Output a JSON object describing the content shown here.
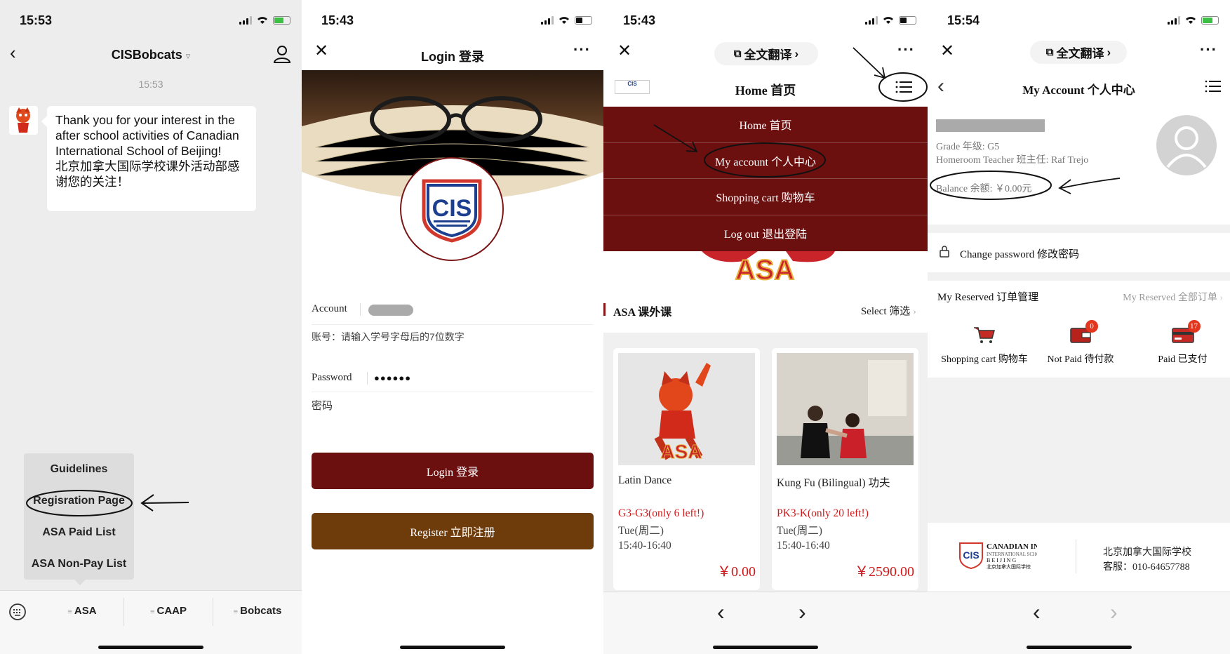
{
  "panel1": {
    "time": "15:53",
    "title": "CISBobcats",
    "timestamp": "15:53",
    "message": "Thank you for your interest in the after school activities of Canadian International School of Beijing!\n北京加拿大国际学校课外活动部感谢您的关注！",
    "menu": [
      "Guidelines",
      "Regisration Page",
      "ASA Paid List",
      "ASA Non-Pay List"
    ],
    "tabs": [
      "ASA",
      "CAAP",
      "Bobcats"
    ]
  },
  "panel2": {
    "time": "15:43",
    "title": "Login 登录",
    "logo_text": "CIS",
    "account_label": "Account",
    "account_placeholder": "账号：请输入学号字母后的7位数字",
    "password_label": "Password",
    "password_value": "●●●●●●",
    "password_placeholder": "密码",
    "login_button": "Login 登录",
    "register_button": "Register 立即注册"
  },
  "panel3": {
    "time": "15:43",
    "translate": "全文翻译",
    "header_title": "Home 首页",
    "menu": [
      "Home 首页",
      "My account 个人中心",
      "Shopping cart 购物车",
      "Log out 退出登陆"
    ],
    "section_title": "ASA 课外课",
    "select_label": "Select 筛选",
    "cards": [
      {
        "name": "Latin Dance",
        "grade": "G3-G3(only 6 left!)",
        "day": "Tue(周二)",
        "time": "15:40-16:40",
        "price": "￥0.00"
      },
      {
        "name": "Kung Fu (Bilingual) 功夫",
        "grade": "PK3-K(only 20 left!)",
        "day": "Tue(周二)",
        "time": "15:40-16:40",
        "price": "￥2590.00"
      }
    ]
  },
  "panel4": {
    "time": "15:54",
    "translate": "全文翻译",
    "title": "My Account 个人中心",
    "grade": "Grade 年级:  G5",
    "homeroom": "Homeroom Teacher 班主任:  Raf Trejo",
    "balance": "Balance 余额:  ￥0.00元",
    "change_password": "Change password 修改密码",
    "reserved_label": "My Reserved 订单管理",
    "reserved_all": "My Reserved 全部订单",
    "orders": [
      {
        "label": "Shopping cart 购物车",
        "badge": ""
      },
      {
        "label": "Not Paid 待付款",
        "badge": "0"
      },
      {
        "label": "Paid 已支付",
        "badge": "17"
      }
    ],
    "footer_logo": "CANADIAN INTERNATIONAL SCHOOL OF BEIJING 北京加拿大国际学校",
    "footer_school": "北京加拿大国际学校",
    "footer_service": "客服：010-64657788"
  },
  "colors": {
    "maroon": "#6b0f0f",
    "brown": "#6e3b0b",
    "price_red": "#d1191b",
    "cis_blue": "#1d3f8f"
  }
}
